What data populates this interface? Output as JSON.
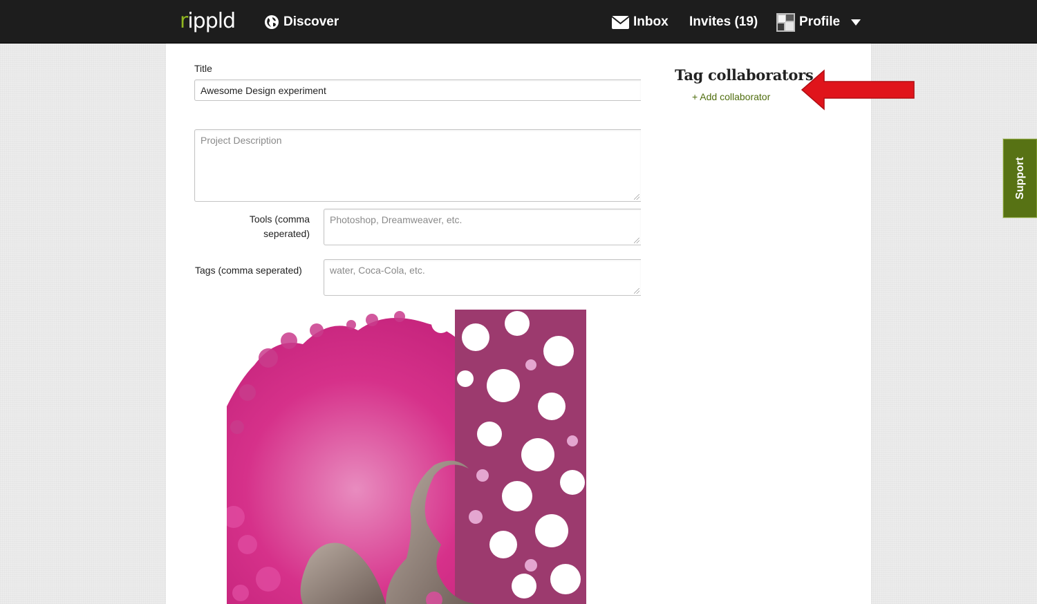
{
  "header": {
    "logo_text": "ippld",
    "logo_mark": "r",
    "nav": {
      "discover": "Discover",
      "inbox": "Inbox",
      "invites": "Invites (19)",
      "profile": "Profile"
    },
    "icons": [
      "globe-icon",
      "envelope-icon",
      "avatar",
      "caret-down-icon"
    ]
  },
  "form": {
    "title_label": "Title",
    "title_value": "Awesome Design experiment",
    "description_placeholder": "Project Description",
    "tools_label": "Tools (comma seperated)",
    "tools_placeholder": "Photoshop, Dreamweaver, etc.",
    "tags_label": "Tags (comma seperated)",
    "tags_placeholder": "water, Coca-Cola, etc."
  },
  "sidebar": {
    "tag_collaborators_title": "Tag collaborators",
    "add_collaborator_link": "+ Add collaborator"
  },
  "support_tab": "Support",
  "colors": {
    "topbar": "#1d1d1d",
    "accent_green": "#577214",
    "link_green": "#4f6d0e",
    "logo_green": "#8fb520",
    "annotation_red": "#e0141b",
    "art_pink": "#d6318a"
  }
}
